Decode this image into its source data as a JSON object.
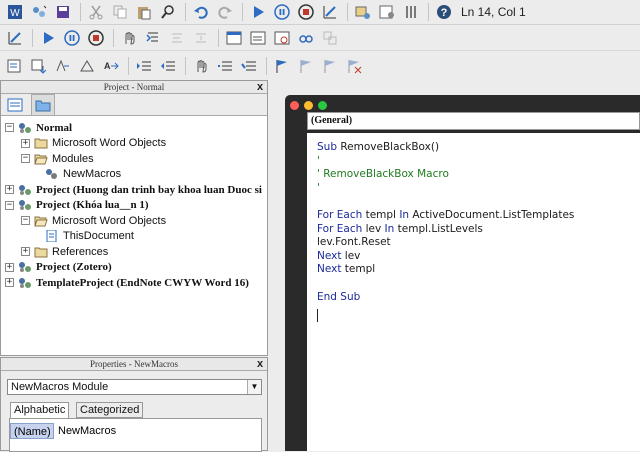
{
  "toolbar": {
    "status": "Ln 14, Col 1"
  },
  "project_panel": {
    "title": "Project - Normal",
    "close": "x",
    "tree": [
      {
        "label": "Normal",
        "style": "serif"
      },
      {
        "label": "Microsoft Word Objects",
        "style": "sans"
      },
      {
        "label": "Modules",
        "style": "sans"
      },
      {
        "label": "NewMacros",
        "style": "sans",
        "selected": true
      },
      {
        "label": "Project (Huong dan trinh bay khoa luan Duoc si",
        "style": "serif"
      },
      {
        "label": "Project (Khóa lua__n 1)",
        "style": "serif"
      },
      {
        "label": "Microsoft Word Objects",
        "style": "sans"
      },
      {
        "label": "ThisDocument",
        "style": "sans"
      },
      {
        "label": "References",
        "style": "sans"
      },
      {
        "label": "Project (Zotero)",
        "style": "serif"
      },
      {
        "label": "TemplateProject (EndNote CWYW Word 16)",
        "style": "serif"
      }
    ]
  },
  "code_window": {
    "object_dropdown": "(General)",
    "lines": [
      {
        "segments": [
          {
            "t": "Sub",
            "c": "kw"
          },
          {
            "t": " RemoveBlackBox()",
            "c": "n"
          }
        ]
      },
      {
        "segments": [
          {
            "t": "'",
            "c": "cm"
          }
        ]
      },
      {
        "segments": [
          {
            "t": "' RemoveBlackBox Macro",
            "c": "cm"
          }
        ]
      },
      {
        "segments": [
          {
            "t": "'",
            "c": "cm"
          }
        ]
      },
      {
        "segments": []
      },
      {
        "segments": [
          {
            "t": "For Each",
            "c": "kw"
          },
          {
            "t": " templ ",
            "c": "n"
          },
          {
            "t": "In",
            "c": "kw"
          },
          {
            "t": " ActiveDocument.ListTemplates",
            "c": "n"
          }
        ]
      },
      {
        "segments": [
          {
            "t": "For Each",
            "c": "kw"
          },
          {
            "t": " lev ",
            "c": "n"
          },
          {
            "t": "In",
            "c": "kw"
          },
          {
            "t": " templ.ListLevels",
            "c": "n"
          }
        ]
      },
      {
        "segments": [
          {
            "t": "lev.Font.Reset",
            "c": "n"
          }
        ]
      },
      {
        "segments": [
          {
            "t": "Next",
            "c": "kw"
          },
          {
            "t": " lev",
            "c": "n"
          }
        ]
      },
      {
        "segments": [
          {
            "t": "Next",
            "c": "kw"
          },
          {
            "t": " templ",
            "c": "n"
          }
        ]
      },
      {
        "segments": []
      },
      {
        "segments": [
          {
            "t": "End Sub",
            "c": "kw"
          }
        ]
      }
    ]
  },
  "properties_panel": {
    "title": "Properties - NewMacros",
    "close": "x",
    "object_select": "NewMacros Module",
    "tabs": [
      "Alphabetic",
      "Categorized"
    ],
    "rows": [
      {
        "name": "(Name)",
        "value": "NewMacros"
      }
    ]
  },
  "colors": {
    "keyword": "#1b2a9a",
    "comment": "#1f7a1f",
    "selection": "#c7d3ee"
  }
}
